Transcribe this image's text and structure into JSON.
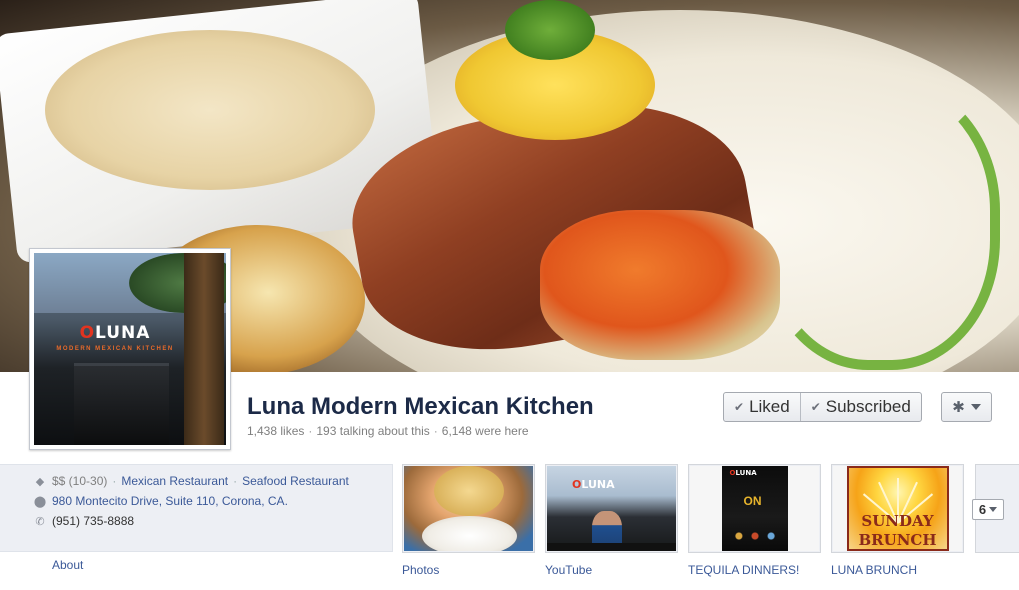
{
  "page": {
    "name": "Luna Modern Mexican Kitchen",
    "likes": "1,438 likes",
    "talking": "193 talking about this",
    "were_here": "6,148 were here"
  },
  "actions": {
    "liked_label": "Liked",
    "subscribed_label": "Subscribed",
    "check_icon": "check-icon",
    "settings_icon": "gear-icon"
  },
  "profile_picture": {
    "sign_text_before": "",
    "sign_o": "O",
    "sign_text_after": "LUNA",
    "sign_subtitle": "MODERN MEXICAN KITCHEN"
  },
  "info": {
    "price": "$$ (10-30)",
    "categories": [
      "Mexican Restaurant",
      "Seafood Restaurant"
    ],
    "address": "980 Montecito Drive, Suite 110, Corona, CA.",
    "phone": "(951) 735-8888",
    "about_label": "About"
  },
  "apps": [
    {
      "label": "Photos"
    },
    {
      "label": "YouTube"
    },
    {
      "label": "TEQUILA DINNERS!"
    },
    {
      "label": "LUNA BRUNCH"
    }
  ],
  "app_thumbs": {
    "youtube_sign": "LUNA",
    "tequila_logo": "LUNA",
    "tequila_big": "ON",
    "brunch_line1": "SUNDAY",
    "brunch_line2": "BRUNCH"
  },
  "more_apps": {
    "count": "6"
  },
  "colors": {
    "link": "#3b5998",
    "page_name": "#1c2a47",
    "info_bg": "#edeff4"
  }
}
